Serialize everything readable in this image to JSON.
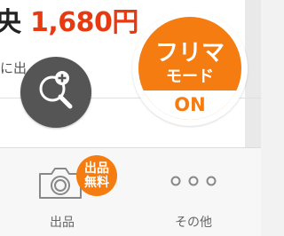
{
  "price": {
    "prefix": "央",
    "value": "1,680円"
  },
  "sub_text": "に出",
  "zoom_button": {
    "icon": "zoom-in-icon"
  },
  "frima_mode": {
    "line1": "フリマ",
    "line2": "モード",
    "status": "ON"
  },
  "tabbar": {
    "items": [
      {
        "label": "出品",
        "icon": "camera-icon",
        "badge_line1": "出品",
        "badge_line2": "無料"
      },
      {
        "label": "その他",
        "icon": "more-dots-icon"
      }
    ]
  },
  "colors": {
    "accent": "#f47c10",
    "price": "#e83a10",
    "zoom_bg": "#555555"
  }
}
